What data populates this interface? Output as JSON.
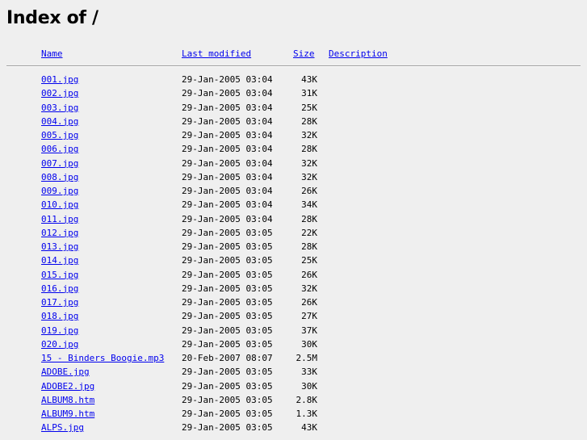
{
  "title": "Index of /",
  "columns": {
    "name": "Name",
    "last_modified": "Last modified",
    "size": "Size",
    "description": "Description"
  },
  "files": [
    {
      "name": "001.jpg",
      "modified": "29-Jan-2005 03:04",
      "size": "43K"
    },
    {
      "name": "002.jpg",
      "modified": "29-Jan-2005 03:04",
      "size": "31K"
    },
    {
      "name": "003.jpg",
      "modified": "29-Jan-2005 03:04",
      "size": "25K"
    },
    {
      "name": "004.jpg",
      "modified": "29-Jan-2005 03:04",
      "size": "28K"
    },
    {
      "name": "005.jpg",
      "modified": "29-Jan-2005 03:04",
      "size": "32K"
    },
    {
      "name": "006.jpg",
      "modified": "29-Jan-2005 03:04",
      "size": "28K"
    },
    {
      "name": "007.jpg",
      "modified": "29-Jan-2005 03:04",
      "size": "32K"
    },
    {
      "name": "008.jpg",
      "modified": "29-Jan-2005 03:04",
      "size": "32K"
    },
    {
      "name": "009.jpg",
      "modified": "29-Jan-2005 03:04",
      "size": "26K"
    },
    {
      "name": "010.jpg",
      "modified": "29-Jan-2005 03:04",
      "size": "34K"
    },
    {
      "name": "011.jpg",
      "modified": "29-Jan-2005 03:04",
      "size": "28K"
    },
    {
      "name": "012.jpg",
      "modified": "29-Jan-2005 03:05",
      "size": "22K"
    },
    {
      "name": "013.jpg",
      "modified": "29-Jan-2005 03:05",
      "size": "28K"
    },
    {
      "name": "014.jpg",
      "modified": "29-Jan-2005 03:05",
      "size": "25K"
    },
    {
      "name": "015.jpg",
      "modified": "29-Jan-2005 03:05",
      "size": "26K"
    },
    {
      "name": "016.jpg",
      "modified": "29-Jan-2005 03:05",
      "size": "32K"
    },
    {
      "name": "017.jpg",
      "modified": "29-Jan-2005 03:05",
      "size": "26K"
    },
    {
      "name": "018.jpg",
      "modified": "29-Jan-2005 03:05",
      "size": "27K"
    },
    {
      "name": "019.jpg",
      "modified": "29-Jan-2005 03:05",
      "size": "37K"
    },
    {
      "name": "020.jpg",
      "modified": "29-Jan-2005 03:05",
      "size": "30K"
    },
    {
      "name": "15 - Binders Boogie.mp3",
      "modified": "20-Feb-2007 08:07",
      "size": "2.5M"
    },
    {
      "name": "ADOBE.jpg",
      "modified": "29-Jan-2005 03:05",
      "size": "33K"
    },
    {
      "name": "ADOBE2.jpg",
      "modified": "29-Jan-2005 03:05",
      "size": "30K"
    },
    {
      "name": "ALBUM8.htm",
      "modified": "29-Jan-2005 03:05",
      "size": "2.8K"
    },
    {
      "name": "ALBUM9.htm",
      "modified": "29-Jan-2005 03:05",
      "size": "1.3K"
    },
    {
      "name": "ALPS.jpg",
      "modified": "29-Jan-2005 03:05",
      "size": "43K"
    }
  ]
}
